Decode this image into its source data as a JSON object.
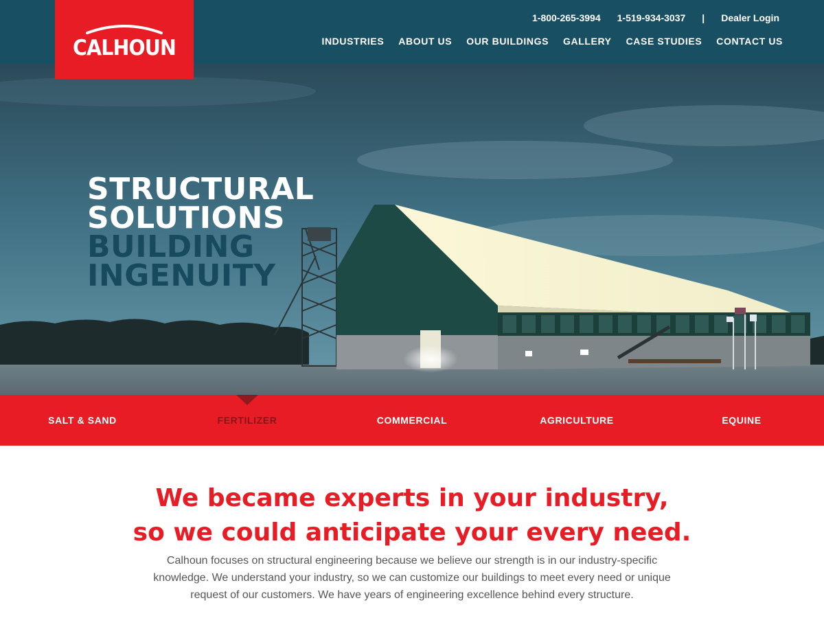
{
  "brand": {
    "name": "CALHOUN",
    "color": "#e81c24",
    "dark_color": "#184f63"
  },
  "header": {
    "phone_1": "1-800-265-3994",
    "phone_2": "1-519-934-3037",
    "separator": "|",
    "dealer_login": "Dealer Login",
    "nav": [
      {
        "label": "INDUSTRIES"
      },
      {
        "label": "ABOUT US"
      },
      {
        "label": "OUR BUILDINGS"
      },
      {
        "label": "GALLERY"
      },
      {
        "label": "CASE STUDIES"
      },
      {
        "label": "CONTACT US"
      }
    ]
  },
  "hero": {
    "line1": "STRUCTURAL",
    "line2": "SOLUTIONS",
    "line3": "BUILDING",
    "line4": "INGENUITY",
    "image": "fabric-storage-building-at-dusk"
  },
  "industries": {
    "active_index": 1,
    "tabs": [
      {
        "label": "SALT & SAND"
      },
      {
        "label": "FERTILIZER"
      },
      {
        "label": "COMMERCIAL"
      },
      {
        "label": "AGRICULTURE"
      },
      {
        "label": "EQUINE"
      }
    ]
  },
  "intro": {
    "headline_1": "We became experts in your industry,",
    "headline_2": "so we could anticipate your every need.",
    "body": "Calhoun focuses on structural engineering because we believe our strength is in our industry-specific knowledge. We understand your industry, so we can customize our buildings to meet every need or unique request of our customers. We have years of engineering excellence behind every structure."
  }
}
